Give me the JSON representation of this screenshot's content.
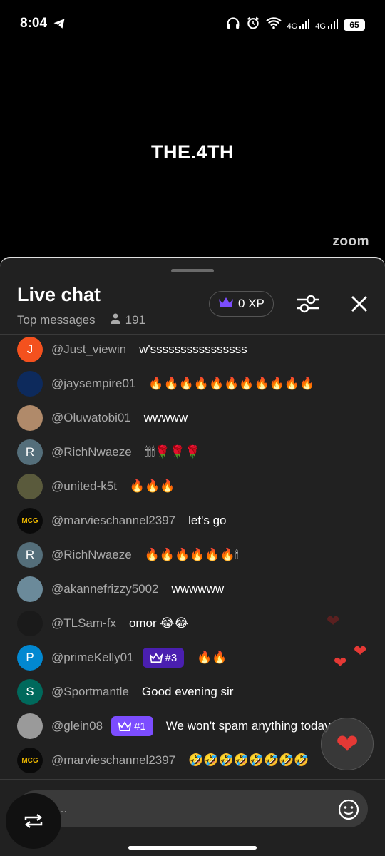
{
  "status_bar": {
    "time": "8:04",
    "network_1": "4G",
    "network_2": "4G",
    "battery": "65",
    "icons": [
      "telegram-icon",
      "headphones-icon",
      "alarm-icon",
      "wifi-icon",
      "signal-icon",
      "battery-icon"
    ]
  },
  "video": {
    "title": "THE.4TH",
    "logo": "zoom"
  },
  "chat": {
    "title": "Live chat",
    "mode": "Top messages",
    "viewer_count": "191",
    "xp": "0 XP",
    "input_placeholder": "Chat...",
    "accent_purple": "#7c4dff",
    "messages": [
      {
        "author": "@Just_viewin",
        "text": "w'ssssssssssssssss",
        "avatar": "J",
        "avatar_color": "#f4511e"
      },
      {
        "author": "@jaysempire01",
        "text": "🔥🔥🔥🔥🔥🔥🔥🔥🔥🔥🔥",
        "avatar": "",
        "avatar_color": "#0d2a5c"
      },
      {
        "author": "@Oluwatobi01",
        "text": "wwwww",
        "avatar": "",
        "avatar_color": "#b08a6a"
      },
      {
        "author": "@RichNwaeze",
        "text": "🕯🕯🕯🌹🌹🌹",
        "avatar": "R",
        "avatar_color": "#546e7a"
      },
      {
        "author": "@united-k5t",
        "text": "🔥🔥🔥",
        "avatar": "",
        "avatar_color": "#5a5a3c"
      },
      {
        "author": "@marvieschannel2397",
        "text": "let's go",
        "avatar": "MCG",
        "avatar_color": "#0a0a0a"
      },
      {
        "author": "@RichNwaeze",
        "text": "🔥🔥🔥🔥🔥🔥🕯",
        "avatar": "R",
        "avatar_color": "#546e7a"
      },
      {
        "author": "@akannefrizzy5002",
        "text": "wwwwww",
        "avatar": "",
        "avatar_color": "#6b8a9a"
      },
      {
        "author": "@TLSam-fx",
        "text": "omor 😂😂",
        "avatar": "",
        "avatar_color": "#1a1a1a"
      },
      {
        "author": "@primeKelly01",
        "text": "🔥🔥",
        "avatar": "P",
        "avatar_color": "#0288d1",
        "badge": "#3",
        "badge_color": "#4a1fb0"
      },
      {
        "author": "@Sportmantle",
        "text": "Good evening sir",
        "avatar": "S",
        "avatar_color": "#00695c"
      },
      {
        "author": "@glein08",
        "text": "We won't spam anything today",
        "avatar": "",
        "avatar_color": "#9a9a9a",
        "badge": "#1",
        "badge_color": "#7c4dff"
      },
      {
        "author": "@marvieschannel2397",
        "text": "🤣🤣🤣🤣🤣🤣🤣🤣",
        "avatar": "MCG",
        "avatar_color": "#0a0a0a"
      }
    ]
  }
}
